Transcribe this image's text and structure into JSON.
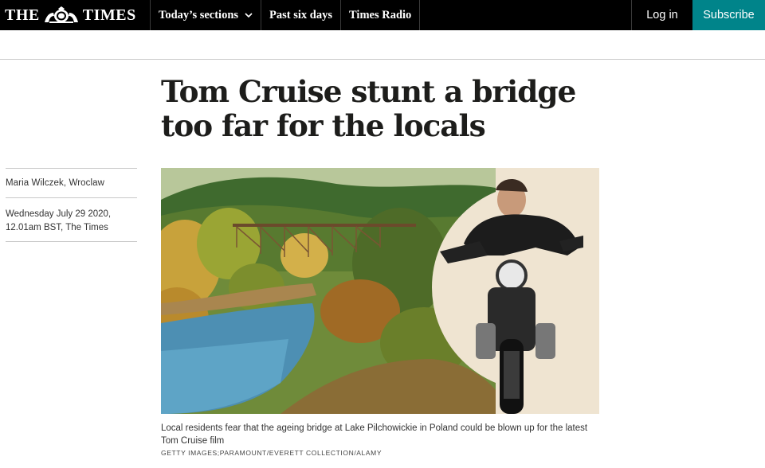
{
  "header": {
    "logo_left": "THE",
    "logo_right": "TIMES",
    "nav": [
      {
        "label": "Today’s sections"
      },
      {
        "label": "Past six days"
      },
      {
        "label": "Times Radio"
      }
    ],
    "login_label": "Log in",
    "subscribe_label": "Subscribe"
  },
  "article": {
    "headline": "Tom Cruise stunt a bridge too far for the locals",
    "author": "Maria Wilczek, Wroclaw",
    "date_line1": "Wednesday July 29 2020,",
    "date_line2": "12.01am BST, The Times",
    "caption": "Local residents fear that the ageing bridge at Lake Pilchowickie in Poland could be blown up for the latest Tom Cruise film",
    "credit": "GETTY IMAGES;PARAMOUNT/EVERETT COLLECTION/ALAMY"
  },
  "colors": {
    "nav_bg": "#000000",
    "subscribe_bg": "#00848a",
    "text": "#1d1d1b"
  }
}
